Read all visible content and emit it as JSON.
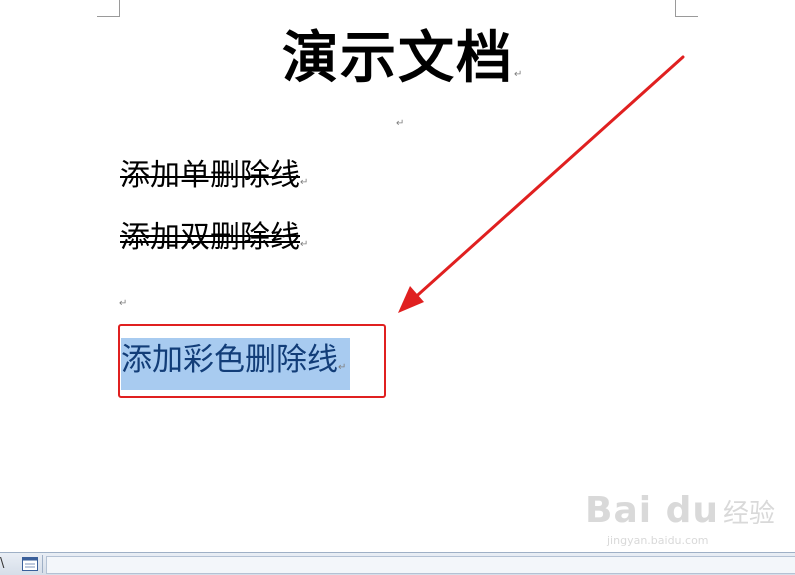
{
  "document": {
    "title": "演示文档",
    "paragraph_mark": "↵",
    "lines": [
      {
        "text": "添加单删除线",
        "style": "single-strikethrough"
      },
      {
        "text": "添加双删除线",
        "style": "double-strikethrough"
      },
      {
        "text": "添加彩色删除线",
        "style": "selected-highlight"
      }
    ]
  },
  "annotation": {
    "box_color": "#e02020",
    "arrow_color": "#e02020"
  },
  "selection": {
    "highlight_color": "#a8cbf0",
    "text_color": "#123d78"
  },
  "watermark": {
    "logo": "Bai du",
    "product": "经验",
    "url": "jingyan.baidu.com"
  },
  "statusbar": {
    "left_glyph": "\\",
    "view_icon": "print-layout-icon"
  }
}
